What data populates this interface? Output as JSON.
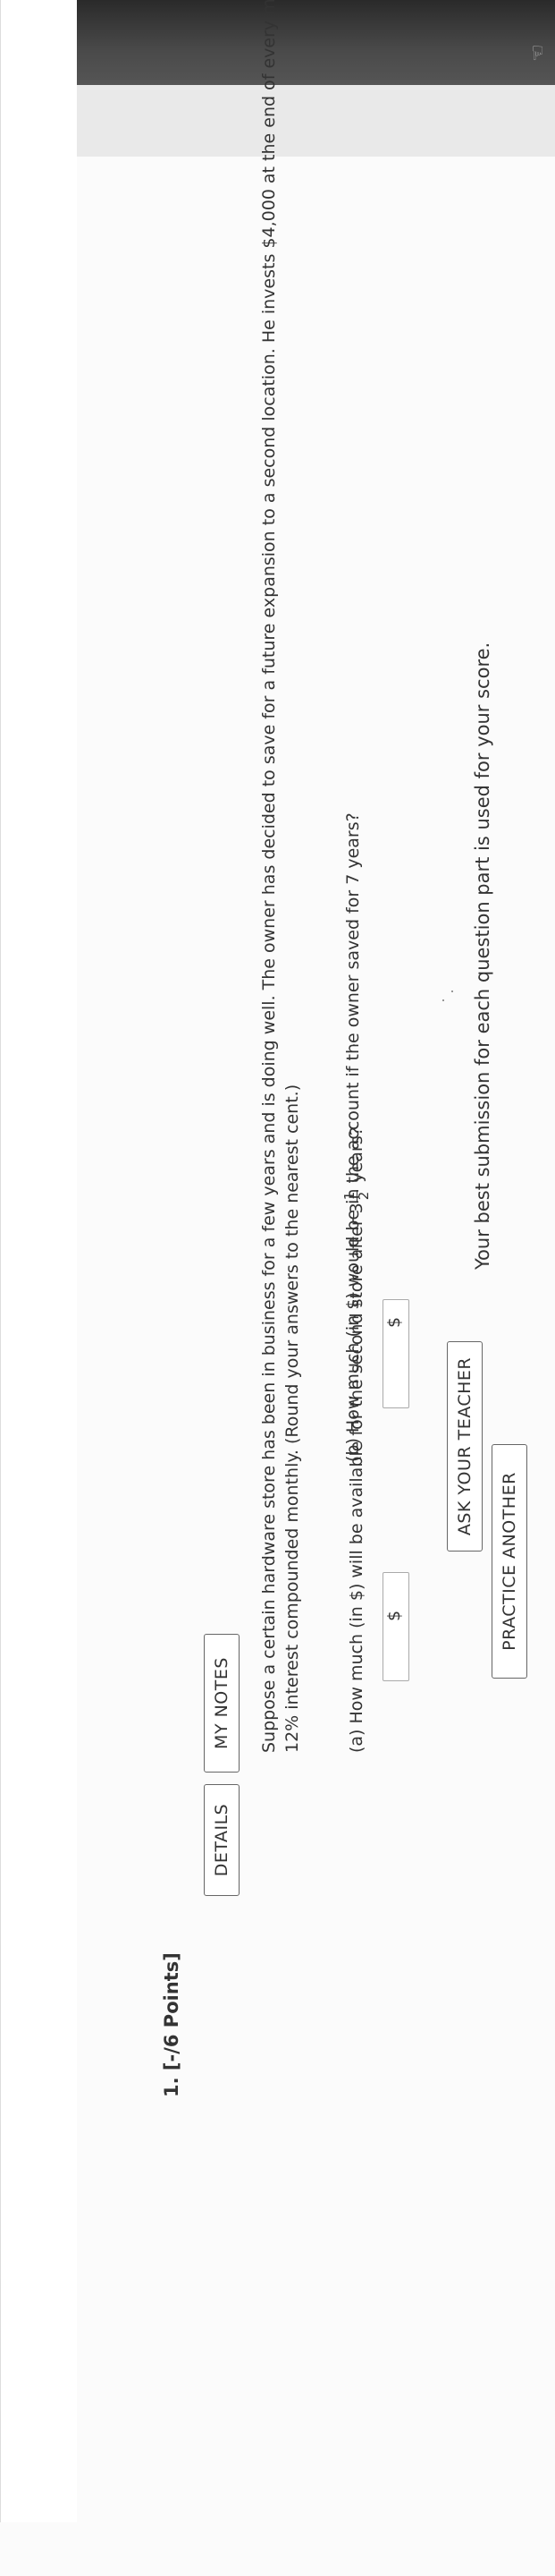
{
  "header": {
    "best_submission_note": "Your best submission for each question part is used for your score."
  },
  "question": {
    "number_label": "1.  [-/6 Points]",
    "details_label": "DETAILS",
    "my_notes_label": "MY NOTES",
    "ask_teacher_label": "ASK YOUR TEACHER",
    "practice_another_label": "PRACTICE ANOTHER",
    "problem_line1": "Suppose a certain hardware store has been in business for a few years and is doing well. The owner has decided to save for a future expansion to a second location. He invests $4,000 at the end of every month at",
    "problem_line2": "12% interest compounded monthly. (Round your answers to the nearest cent.)",
    "part_a_prefix": "(a)   How much (in $) will be available for the second store after 3",
    "part_a_frac_num": "1",
    "part_a_frac_den": "2",
    "part_a_suffix": " years?",
    "part_b": "(b)   How much (in $) would be in the account if the owner saved for 7 years?",
    "currency": "$"
  }
}
